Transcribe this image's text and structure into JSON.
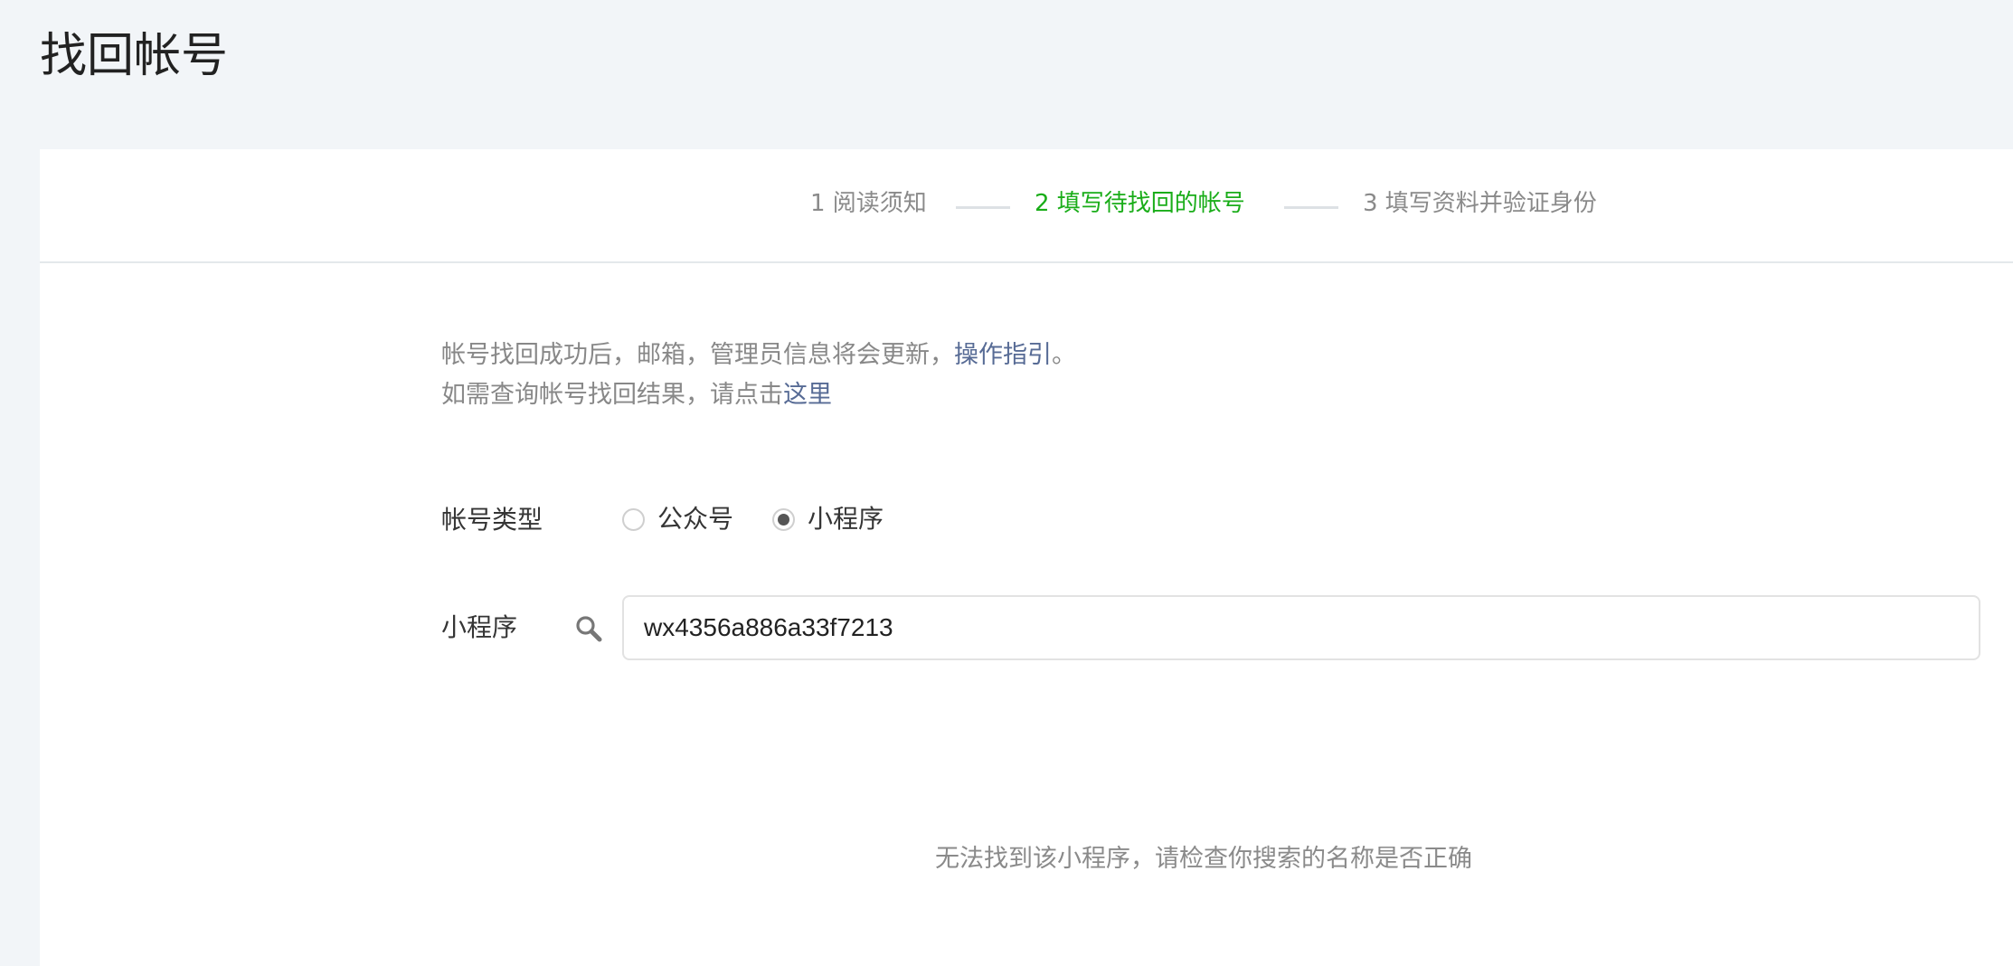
{
  "page": {
    "title": "找回帐号"
  },
  "steps": [
    {
      "label": "1 阅读须知",
      "state": "done"
    },
    {
      "label": "2 填写待找回的帐号",
      "state": "active"
    },
    {
      "label": "3 填写资料并验证身份",
      "state": "pending"
    }
  ],
  "notice": {
    "line1_text": "帐号找回成功后，邮箱，管理员信息将会更新，",
    "line1_link": "操作指引",
    "line1_end": "。",
    "line2_text": "如需查询帐号找回结果，请点击",
    "line2_link": "这里"
  },
  "form": {
    "account_type_label": "帐号类型",
    "options": [
      {
        "label": "公众号",
        "selected": false
      },
      {
        "label": "小程序",
        "selected": true
      }
    ],
    "search_label": "小程序",
    "search_value": "wx4356a886a33f7213",
    "search_icon": "search-icon"
  },
  "result": {
    "empty_message": "无法找到该小程序，请检查你搜索的名称是否正确"
  },
  "colors": {
    "accent_green": "#1aad19",
    "link_blue": "#576b95",
    "background": "#f2f5f8"
  }
}
